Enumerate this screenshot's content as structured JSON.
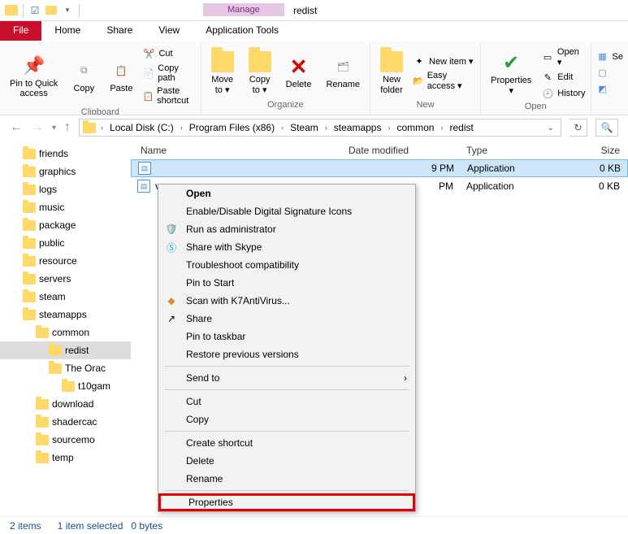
{
  "window": {
    "title": "redist",
    "contextual_tab_header": "Manage"
  },
  "tabs": {
    "file": "File",
    "home": "Home",
    "share": "Share",
    "view": "View",
    "application_tools": "Application Tools"
  },
  "ribbon": {
    "pin_quick": "Pin to Quick\naccess",
    "copy": "Copy",
    "paste": "Paste",
    "cut": "Cut",
    "copy_path": "Copy path",
    "paste_shortcut": "Paste shortcut",
    "move_to": "Move\nto ▾",
    "copy_to": "Copy\nto ▾",
    "delete": "Delete",
    "rename": "Rename",
    "new_folder": "New\nfolder",
    "new_item": "New item ▾",
    "easy_access": "Easy access ▾",
    "properties": "Properties\n▾",
    "open": "Open ▾",
    "edit": "Edit",
    "history": "History",
    "select_all_ico": "Se",
    "groups": {
      "clipboard": "Clipboard",
      "organize": "Organize",
      "new": "New",
      "open": "Open"
    }
  },
  "breadcrumbs": {
    "items": [
      "Local Disk (C:)",
      "Program Files (x86)",
      "Steam",
      "steamapps",
      "common",
      "redist"
    ]
  },
  "tree": {
    "items": [
      {
        "label": "friends",
        "indent": 1
      },
      {
        "label": "graphics",
        "indent": 1
      },
      {
        "label": "logs",
        "indent": 1
      },
      {
        "label": "music",
        "indent": 1
      },
      {
        "label": "package",
        "indent": 1
      },
      {
        "label": "public",
        "indent": 1
      },
      {
        "label": "resource",
        "indent": 1
      },
      {
        "label": "servers",
        "indent": 1
      },
      {
        "label": "steam",
        "indent": 1
      },
      {
        "label": "steamapps",
        "indent": 1
      },
      {
        "label": "common",
        "indent": 2
      },
      {
        "label": "redist",
        "indent": 3,
        "selected": true
      },
      {
        "label": "The Orac",
        "indent": 3
      },
      {
        "label": "t10gam",
        "indent": 4
      },
      {
        "label": "download",
        "indent": 2
      },
      {
        "label": "shadercac",
        "indent": 2
      },
      {
        "label": "sourcemo",
        "indent": 2
      },
      {
        "label": "temp",
        "indent": 2
      }
    ]
  },
  "columns": {
    "name": "Name",
    "date": "Date modified",
    "type": "Type",
    "size": "Size"
  },
  "files": {
    "rows": [
      {
        "date_partial": "9 PM",
        "type": "Application",
        "size": "0 KB",
        "selected": true
      },
      {
        "name_partial": "v",
        "date_partial": " PM",
        "type": "Application",
        "size": "0 KB"
      }
    ]
  },
  "context_menu": {
    "open": "Open",
    "enable_icons": "Enable/Disable Digital Signature Icons",
    "run_admin": "Run as administrator",
    "skype": "Share with Skype",
    "troubleshoot": "Troubleshoot compatibility",
    "pin_start": "Pin to Start",
    "k7": "Scan with K7AntiVirus...",
    "share": "Share",
    "pin_taskbar": "Pin to taskbar",
    "restore": "Restore previous versions",
    "send_to": "Send to",
    "cut": "Cut",
    "copy": "Copy",
    "create_shortcut": "Create shortcut",
    "delete": "Delete",
    "rename": "Rename",
    "properties": "Properties"
  },
  "status": {
    "line": "2 items      1 item selected   0 bytes"
  }
}
